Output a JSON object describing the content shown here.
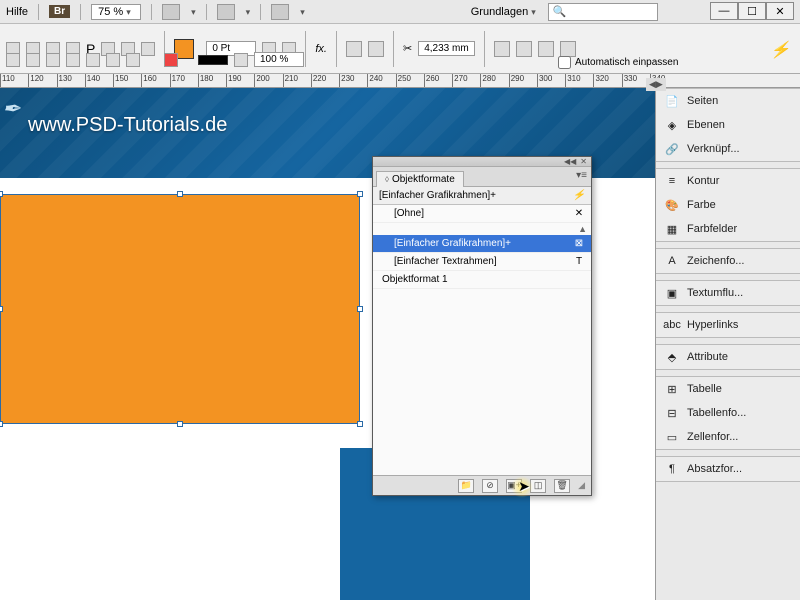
{
  "menubar": {
    "help": "Hilfe",
    "br": "Br",
    "zoom": "75 %",
    "workspace": "Grundlagen"
  },
  "window_controls": {
    "min": "—",
    "max": "☐",
    "close": "✕"
  },
  "toolbar": {
    "swatch_color": "#f39322",
    "stroke_pt": "0 Pt",
    "pct": "100 %",
    "meas": "4,233 mm",
    "autofit": "Automatisch einpassen"
  },
  "ruler": {
    "start": 110,
    "end": 340,
    "step": 10
  },
  "canvas": {
    "url": "www.PSD-Tutorials.de"
  },
  "right_panels": [
    {
      "icon": "📄",
      "label": "Seiten"
    },
    {
      "icon": "◈",
      "label": "Ebenen"
    },
    {
      "icon": "🔗",
      "label": "Verknüpf..."
    },
    {
      "icon": "≡",
      "label": "Kontur"
    },
    {
      "icon": "🎨",
      "label": "Farbe"
    },
    {
      "icon": "▦",
      "label": "Farbfelder"
    },
    {
      "icon": "A",
      "label": "Zeichenfo..."
    },
    {
      "icon": "▣",
      "label": "Textumflu..."
    },
    {
      "icon": "abc",
      "label": "Hyperlinks"
    },
    {
      "icon": "⬘",
      "label": "Attribute"
    },
    {
      "icon": "⊞",
      "label": "Tabelle"
    },
    {
      "icon": "⊟",
      "label": "Tabellenfo..."
    },
    {
      "icon": "▭",
      "label": "Zellenfor..."
    },
    {
      "icon": "¶",
      "label": "Absatzfor..."
    }
  ],
  "floating": {
    "title": "Objektformate",
    "header": "[Einfacher Grafikrahmen]+",
    "rows": [
      {
        "label": "[Ohne]",
        "end": "✕",
        "sel": false
      },
      {
        "label": "[Einfacher Grafikrahmen]+",
        "end": "⊠",
        "sel": true
      },
      {
        "label": "[Einfacher Textrahmen]",
        "end": "T",
        "sel": false
      },
      {
        "label": "Objektformat 1",
        "end": "",
        "sel": false,
        "noindent": true
      }
    ]
  },
  "panel_groups": [
    [
      0,
      1,
      2
    ],
    [
      3,
      4,
      5
    ],
    [
      6
    ],
    [
      7
    ],
    [
      8
    ],
    [
      9
    ],
    [
      10,
      11,
      12
    ],
    [
      13
    ]
  ]
}
